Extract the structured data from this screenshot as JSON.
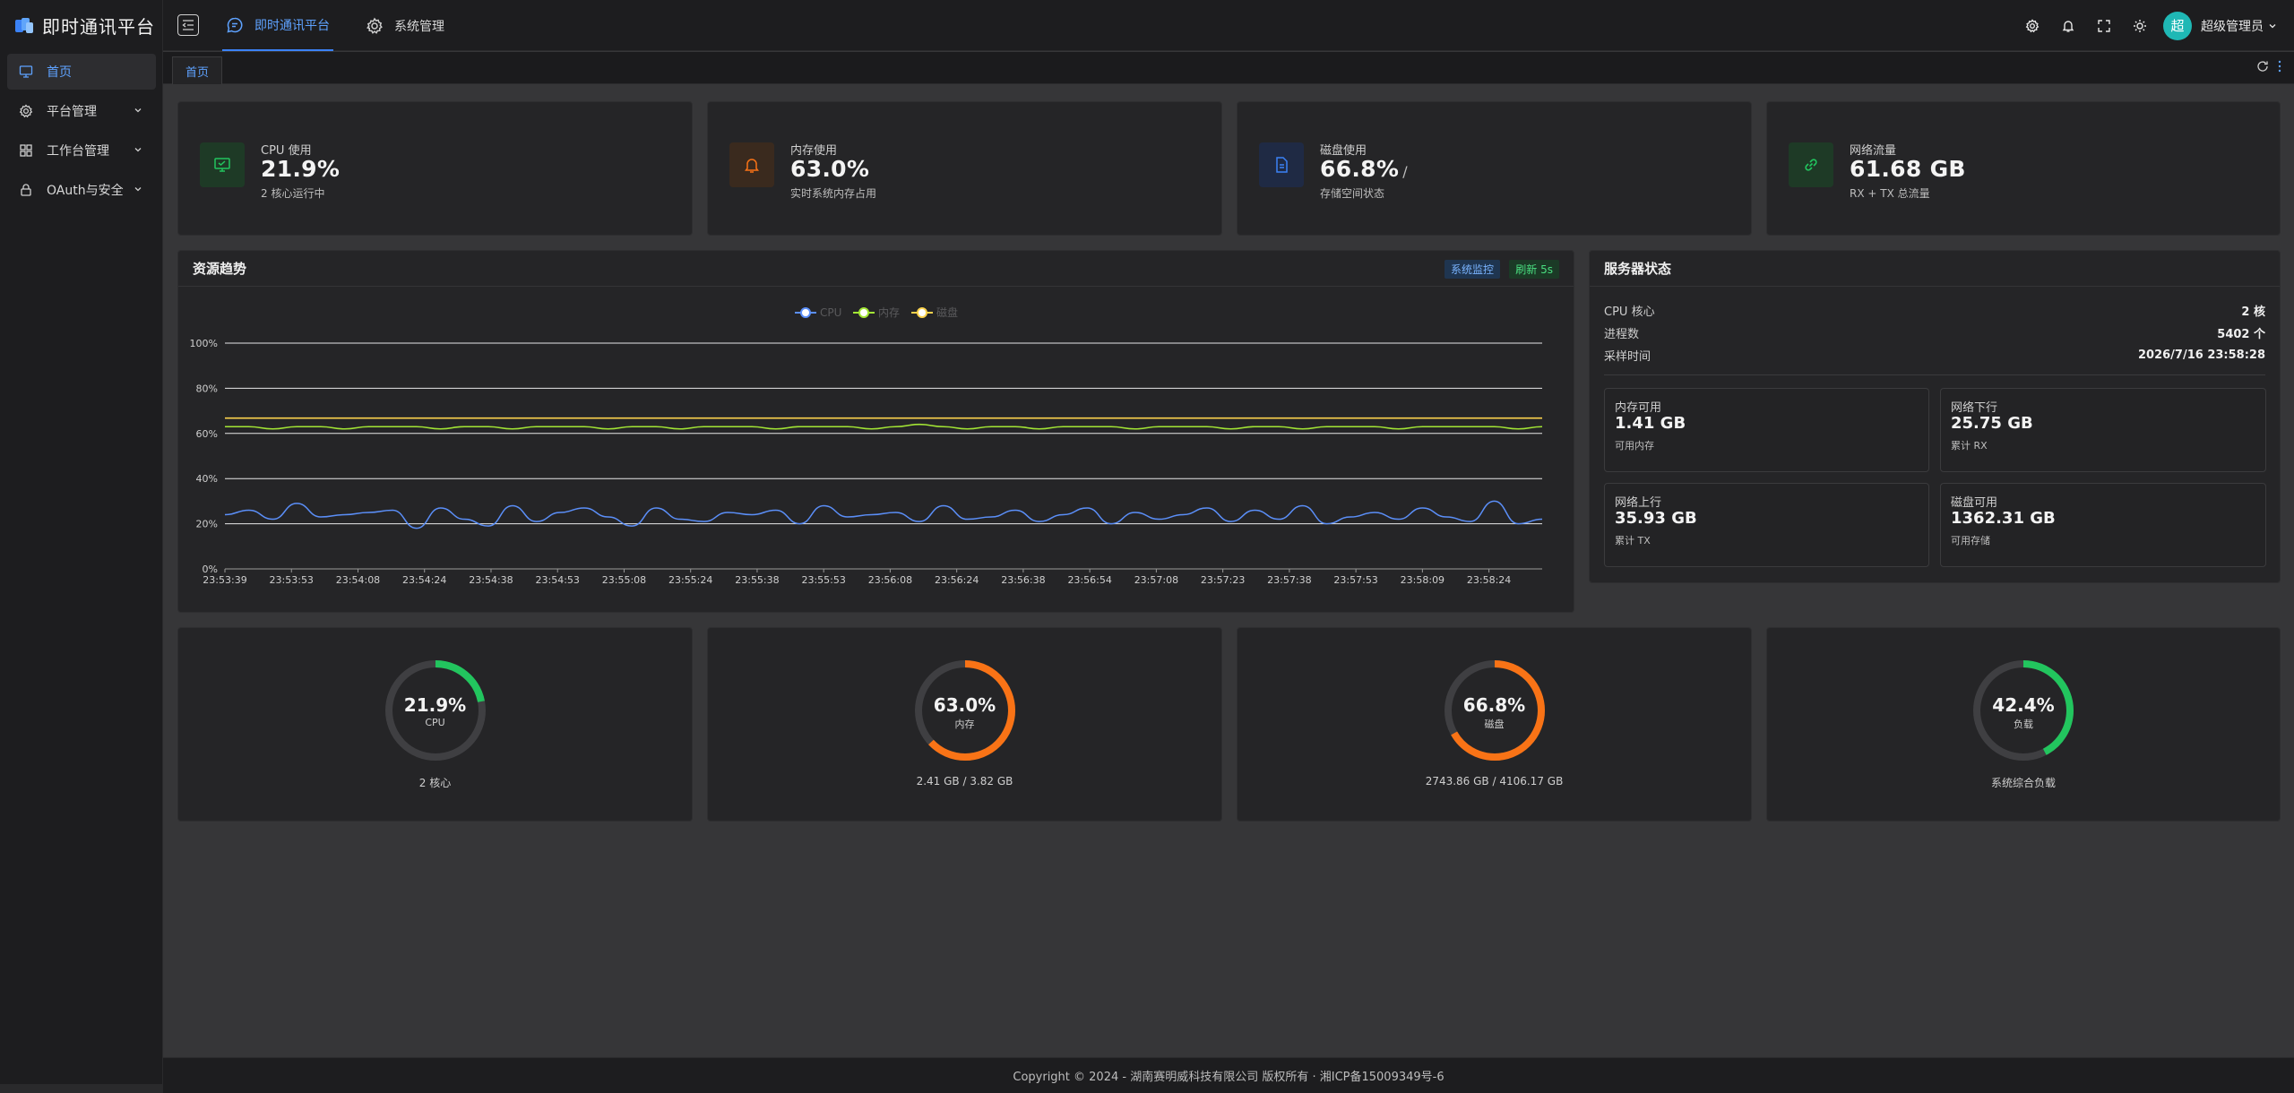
{
  "app": {
    "title": "即时通讯平台"
  },
  "sidebar": {
    "items": [
      {
        "label": "首页",
        "icon": "monitor-icon",
        "active": true
      },
      {
        "label": "平台管理",
        "icon": "gear-icon"
      },
      {
        "label": "工作台管理",
        "icon": "grid-icon"
      },
      {
        "label": "OAuth与安全",
        "icon": "lock-icon"
      }
    ]
  },
  "header": {
    "tabs": [
      {
        "label": "即时通讯平台",
        "active": true
      },
      {
        "label": "系统管理"
      }
    ],
    "user": {
      "avatar_text": "超",
      "name": "超级管理员"
    }
  },
  "tabstrip": {
    "tabs": [
      {
        "label": "首页"
      }
    ]
  },
  "stats": [
    {
      "label": "CPU 使用",
      "value": "21.9%",
      "unit": "",
      "desc": "2 核心运行中",
      "icon": "monitor-icon",
      "color": "#22c55e"
    },
    {
      "label": "内存使用",
      "value": "63.0%",
      "unit": "",
      "desc": "实时系统内存占用",
      "icon": "bell-icon",
      "color": "#f97316"
    },
    {
      "label": "磁盘使用",
      "value": "66.8%",
      "unit": "/",
      "desc": "存储空间状态",
      "icon": "file-icon",
      "color": "#3b82f6"
    },
    {
      "label": "网络流量",
      "value": "61.68 GB",
      "unit": "",
      "desc": "RX + TX 总流量",
      "icon": "link-icon",
      "color": "#22c55e"
    }
  ],
  "trend": {
    "title": "资源趋势",
    "badges": [
      {
        "label": "系统监控",
        "color": "#5ea2ff"
      },
      {
        "label": "刷新 5s",
        "color": "#22c55e"
      }
    ]
  },
  "chart_data": {
    "type": "line",
    "title": "",
    "xlabel": "",
    "ylabel": "",
    "ylim": [
      0,
      100
    ],
    "y_ticks": [
      "0%",
      "20%",
      "40%",
      "60%",
      "80%",
      "100%"
    ],
    "grid": true,
    "legend_position": "top",
    "x_tick_labels": [
      "23:53:39",
      "23:53:53",
      "23:54:08",
      "23:54:24",
      "23:54:38",
      "23:54:53",
      "23:55:08",
      "23:55:24",
      "23:55:38",
      "23:55:53",
      "23:56:08",
      "23:56:24",
      "23:56:38",
      "23:56:54",
      "23:57:08",
      "23:57:23",
      "23:57:38",
      "23:57:53",
      "23:58:09",
      "23:58:24"
    ],
    "series": [
      {
        "name": "CPU",
        "color": "#5b8ff9",
        "values": [
          24,
          26,
          22,
          29,
          23,
          24,
          25,
          26,
          18,
          27,
          22,
          19,
          28,
          21,
          25,
          27,
          23,
          19,
          27,
          22,
          21,
          25,
          24,
          26,
          20,
          28,
          23,
          24,
          25,
          21,
          28,
          22,
          23,
          26,
          21,
          24,
          27,
          20,
          25,
          22,
          24,
          27,
          21,
          26,
          22,
          28,
          20,
          23,
          25,
          22,
          27,
          23,
          21,
          30,
          20,
          22
        ]
      },
      {
        "name": "内存",
        "color": "#a3e635",
        "values": [
          63,
          63,
          62,
          63,
          63,
          62,
          63,
          63,
          63,
          62,
          63,
          63,
          62,
          63,
          63,
          63,
          62,
          63,
          63,
          62,
          63,
          63,
          63,
          62,
          63,
          63,
          63,
          62,
          63,
          64,
          63,
          62,
          63,
          63,
          62,
          63,
          63,
          63,
          62,
          63,
          63,
          63,
          62,
          63,
          63,
          62,
          63,
          63,
          63,
          62,
          63,
          63,
          63,
          63,
          62,
          63
        ]
      },
      {
        "name": "磁盘",
        "color": "#fcd34d",
        "values": [
          66.8,
          66.8,
          66.8,
          66.8,
          66.8,
          66.8,
          66.8,
          66.8,
          66.8,
          66.8,
          66.8,
          66.8,
          66.8,
          66.8,
          66.8,
          66.8,
          66.8,
          66.8,
          66.8,
          66.8,
          66.8,
          66.8,
          66.8,
          66.8,
          66.8,
          66.8,
          66.8,
          66.8,
          66.8,
          66.8,
          66.8,
          66.8,
          66.8,
          66.8,
          66.8,
          66.8,
          66.8,
          66.8,
          66.8,
          66.8,
          66.8,
          66.8,
          66.8,
          66.8,
          66.8,
          66.8,
          66.8,
          66.8,
          66.8,
          66.8,
          66.8,
          66.8,
          66.8,
          66.8,
          66.8,
          66.8
        ]
      }
    ]
  },
  "server": {
    "title": "服务器状态",
    "rows": [
      {
        "label": "CPU 核心",
        "value": "2 核"
      },
      {
        "label": "进程数",
        "value": "5402 个"
      },
      {
        "label": "采样时间",
        "value": "2026/7/16 23:58:28"
      }
    ],
    "cards": [
      {
        "title": "内存可用",
        "value": "1.41 GB",
        "desc": "可用内存"
      },
      {
        "title": "网络下行",
        "value": "25.75 GB",
        "desc": "累计 RX"
      },
      {
        "title": "网络上行",
        "value": "35.93 GB",
        "desc": "累计 TX"
      },
      {
        "title": "磁盘可用",
        "value": "1362.31 GB",
        "desc": "可用存储"
      }
    ]
  },
  "gauges": [
    {
      "value": "21.9%",
      "percent": 21.9,
      "label": "CPU",
      "desc": "2 核心",
      "color": "#22c55e"
    },
    {
      "value": "63.0%",
      "percent": 63.0,
      "label": "内存",
      "desc": "2.41 GB / 3.82 GB",
      "color": "#f97316"
    },
    {
      "value": "66.8%",
      "percent": 66.8,
      "label": "磁盘",
      "desc": "2743.86 GB / 4106.17 GB",
      "color": "#f97316"
    },
    {
      "value": "42.4%",
      "percent": 42.4,
      "label": "负载",
      "desc": "系统综合负载",
      "color": "#22c55e"
    }
  ],
  "footer": {
    "text": "Copyright © 2024 - 湖南赛明威科技有限公司 版权所有 · 湘ICP备15009349号-6"
  }
}
